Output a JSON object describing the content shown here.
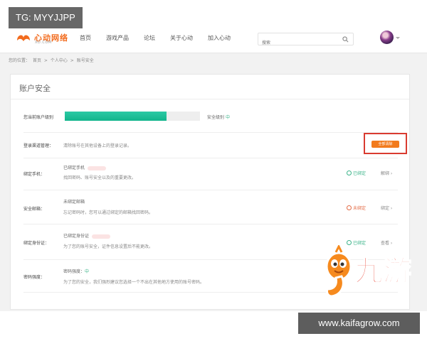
{
  "watermarks": {
    "tag": "TG: MYYJJPP",
    "site": "www.kaifagrow.com",
    "logo_text": "九游"
  },
  "header": {
    "logo_text": "心动网络",
    "logo_sub": "XD.COM",
    "nav": [
      "首页",
      "游戏产品",
      "论坛",
      "关于心动",
      "加入心动"
    ],
    "search_placeholder": "搜索"
  },
  "breadcrumb": [
    "您的位置：",
    "首页",
    ">",
    "个人中心",
    ">",
    "账号安全"
  ],
  "card": {
    "title": "账户安全",
    "level": {
      "label": "您当前账户级别",
      "progress": 0.75,
      "text": "安全级别",
      "value": "中"
    },
    "login": {
      "label": "登录渠道管理：",
      "desc": "清除账号在其他设备上的登录记录。",
      "button": "全部清除"
    },
    "phone": {
      "label": "绑定手机：",
      "status_line": "已绑定手机",
      "desc": "找回密码、账号安全以及的重要更改。",
      "status": "已绑定",
      "action": "解绑"
    },
    "email": {
      "label": "安全邮箱：",
      "status_line": "未绑定邮箱",
      "desc": "忘记密码时，您可以通过绑定的邮箱找回密码。",
      "status": "未绑定",
      "action": "绑定"
    },
    "idcard": {
      "label": "绑定身份证：",
      "status_line": "已绑定身份证",
      "desc": "为了您的账号安全，证件信息设置后不能更改。",
      "status": "已绑定",
      "action": "查看"
    },
    "password": {
      "label": "密码强度：",
      "status_line_prefix": "密码强度：",
      "status_line_value": "中",
      "desc": "为了您的安全，我们强烈建议您选择一个不出在其他地方使用的账号密码。"
    }
  },
  "colors": {
    "accent_orange": "#f27b1d",
    "highlight_red": "#d93b30",
    "progress_green": "#13b58c",
    "status_ok": "#3cb48a",
    "status_warn": "#e46b45"
  }
}
